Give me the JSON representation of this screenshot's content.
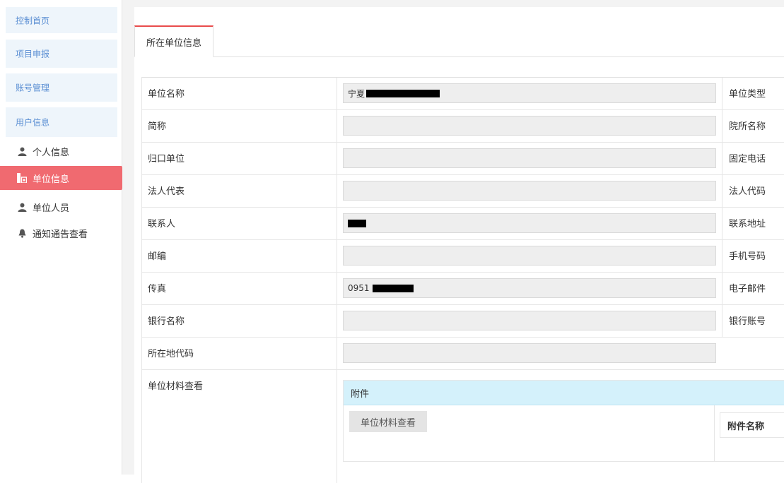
{
  "sidebar": {
    "nav": [
      "控制首页",
      "项目申报",
      "账号管理",
      "用户信息"
    ],
    "items": [
      {
        "label": "个人信息",
        "icon": "user-icon"
      },
      {
        "label": "单位信息",
        "icon": "building-icon"
      },
      {
        "label": "单位人员",
        "icon": "user-icon"
      },
      {
        "label": "通知通告查看",
        "icon": "bell-icon"
      }
    ],
    "active_color": "#f06a70"
  },
  "tab": {
    "label": "所在单位信息",
    "accent": "#e94c4c"
  },
  "form": {
    "rows": [
      {
        "left_label": "单位名称",
        "value": "宁夏",
        "right_label": "单位类型"
      },
      {
        "left_label": "简称",
        "value": "",
        "right_label": "院所名称"
      },
      {
        "left_label": "归口单位",
        "value": "",
        "right_label": "固定电话"
      },
      {
        "left_label": "法人代表",
        "value": "",
        "right_label": "法人代码"
      },
      {
        "left_label": "联系人",
        "value": "",
        "right_label": "联系地址"
      },
      {
        "left_label": "邮编",
        "value": "",
        "right_label": "手机号码"
      },
      {
        "left_label": "传真",
        "value": "0951",
        "right_label": "电子邮件"
      },
      {
        "left_label": "银行名称",
        "value": "",
        "right_label": "银行账号"
      },
      {
        "left_label": "所在地代码",
        "value": "",
        "right_label": ""
      }
    ],
    "materials_label": "单位材料查看"
  },
  "attachments": {
    "header": "附件",
    "view_button": "单位材料查看",
    "column_name": "附件名称",
    "header_bg": "#d4f1fb"
  }
}
